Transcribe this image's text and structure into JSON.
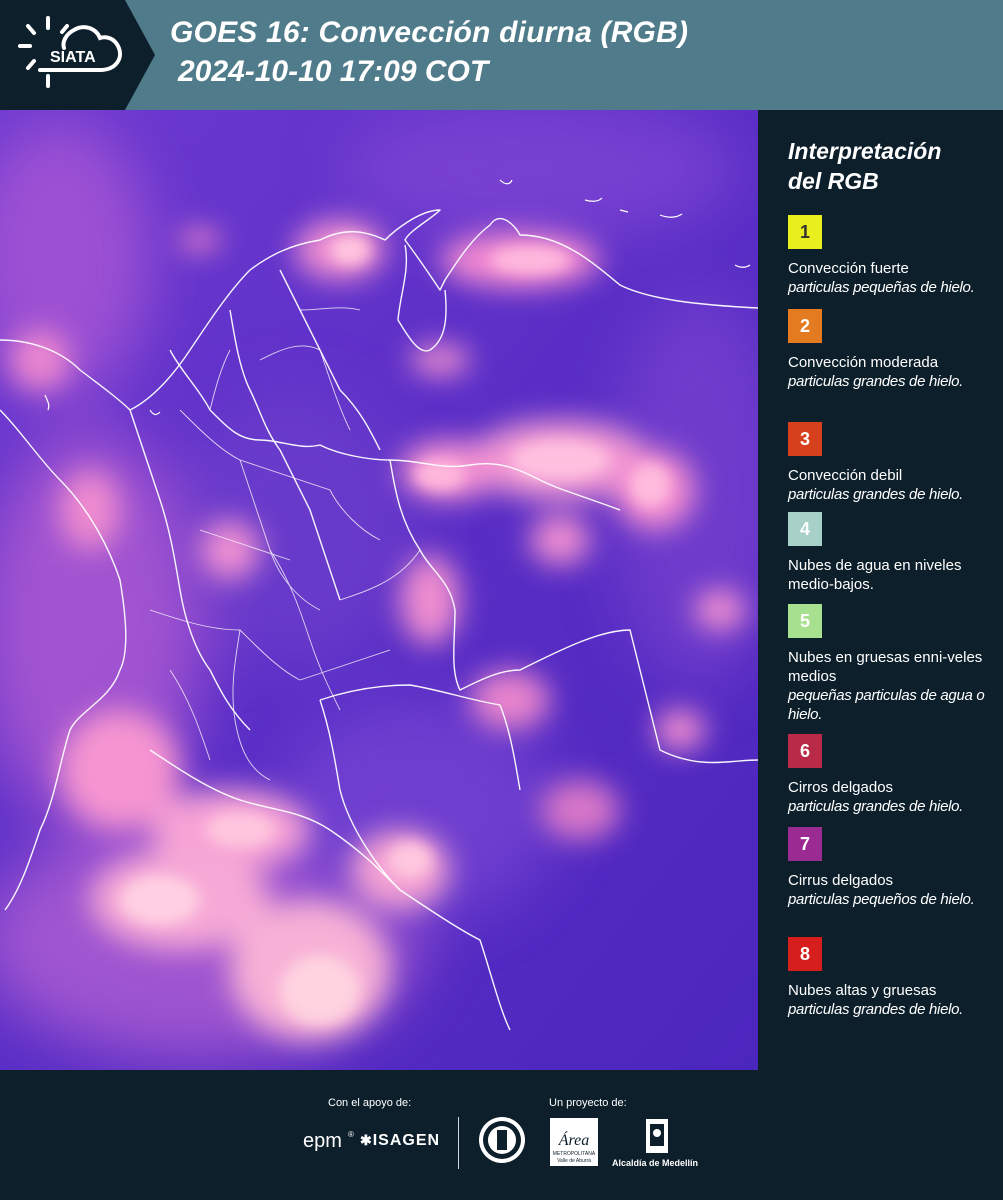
{
  "header": {
    "logo_text": "SIATA",
    "title_line1": "GOES 16: Convección diurna (RGB)",
    "title_line2": "2024-10-10 17:09 COT"
  },
  "legend": {
    "title_line1": "Interpretación",
    "title_line2": "del RGB",
    "items": [
      {
        "number": "1",
        "color": "#e8ef1c",
        "text_color": "#333333",
        "main": "Convección fuerte",
        "sub": "particulas pequeñas de hielo."
      },
      {
        "number": "2",
        "color": "#e57b21",
        "text_color": "#ffffff",
        "main": "Convección moderada",
        "sub": "particulas grandes de hielo."
      },
      {
        "number": "3",
        "color": "#d6401c",
        "text_color": "#ffffff",
        "main": "Convección debil",
        "sub": "particulas grandes de hielo."
      },
      {
        "number": "4",
        "color": "#a6d0c8",
        "text_color": "#ffffff",
        "main": "Nubes de agua en niveles medio-bajos.",
        "sub": ""
      },
      {
        "number": "5",
        "color": "#a7e08f",
        "text_color": "#ffffff",
        "main": "Nubes en gruesas enni-veles medios",
        "sub": "pequeñas particulas de agua o hielo."
      },
      {
        "number": "6",
        "color": "#b82a47",
        "text_color": "#ffffff",
        "main": "Cirros delgados",
        "sub": "particulas grandes de hielo."
      },
      {
        "number": "7",
        "color": "#9b2a93",
        "text_color": "#ffffff",
        "main": "Cirrus delgados",
        "sub": "particulas pequeños de hielo."
      },
      {
        "number": "8",
        "color": "#d61f1c",
        "text_color": "#ffffff",
        "main": "Nubes altas y gruesas",
        "sub": "particulas grandes de hielo."
      }
    ]
  },
  "footer": {
    "support_label": "Con el apoyo de:",
    "project_label": "Un proyecto de:",
    "sponsor1": "epm",
    "sponsor2": "ISAGEN",
    "partner_area": "Área",
    "partner_area_sub1": "METROPOLITANA",
    "partner_area_sub2": "Valle de Aburrá",
    "partner_alcaldia": "Alcaldía de Medellín"
  },
  "colors": {
    "header_bg": "#4f7b8a",
    "panel_bg": "#0d1f2b",
    "map_base": "#5a2fc7",
    "cloud_pink": "#f58bd0",
    "border_white": "#ffffff"
  }
}
